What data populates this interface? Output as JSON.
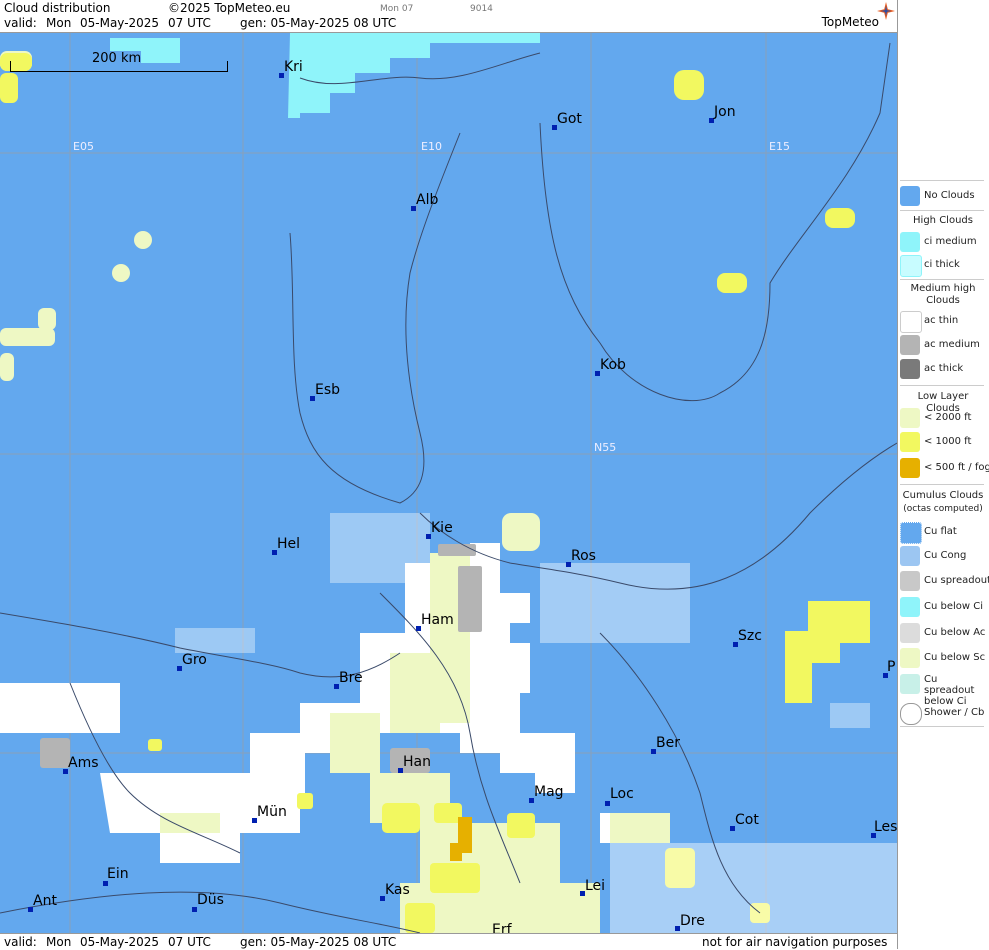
{
  "header": {
    "title": "Cloud distribution",
    "copyright": "©2025 TopMeteo.eu",
    "small1": "Mon 07",
    "small2": "9014",
    "valid_label": "valid:",
    "valid_day": "Mon",
    "valid_date": "05-May-2025",
    "valid_time": "07 UTC",
    "gen": "gen: 05-May-2025 08 UTC",
    "logo": "TopMeteo"
  },
  "footer": {
    "valid_label": "valid:",
    "valid_day": "Mon",
    "valid_date": "05-May-2025",
    "valid_time": "07 UTC",
    "gen": "gen: 05-May-2025 08 UTC",
    "disclaimer": "not for air navigation purposes"
  },
  "map": {
    "scale_label": "200 km",
    "coords": {
      "e05": "E05",
      "e10": "E10",
      "e15": "E15",
      "n55": "N55"
    },
    "cities": {
      "kri": "Kri",
      "got": "Got",
      "jon": "Jon",
      "alb": "Alb",
      "kob": "Kob",
      "esb": "Esb",
      "kie": "Kie",
      "hel": "Hel",
      "ros": "Ros",
      "ham": "Ham",
      "szc": "Szc",
      "gro": "Gro",
      "bre": "Bre",
      "p": "P",
      "ber": "Ber",
      "ams": "Ams",
      "han": "Han",
      "mag": "Mag",
      "loc": "Loc",
      "mun": "Mün",
      "cot": "Cot",
      "les": "Les",
      "ein": "Ein",
      "lei": "Lei",
      "kas": "Kas",
      "ant": "Ant",
      "dus": "Düs",
      "dre": "Dre",
      "erf": "Erf"
    },
    "colors": {
      "no_clouds": "#63a8ee",
      "ci_medium": "#8ff4fa",
      "low_2000": "#eef8c4",
      "low_1000": "#f2f860",
      "fog": "#e6b000",
      "ac_medium": "#b4b4b4",
      "white": "#ffffff"
    }
  },
  "legend": {
    "no_clouds": "No Clouds",
    "high_clouds": "High Clouds",
    "ci_medium": "ci medium",
    "ci_thick": "ci thick",
    "medium_high": "Medium high Clouds",
    "ac_thin": "ac thin",
    "ac_medium": "ac medium",
    "ac_thick": "ac thick",
    "low_layer": "Low Layer Clouds",
    "lt2000": "< 2000 ft",
    "lt1000": "< 1000 ft",
    "lt500": "< 500 ft / fog",
    "cumulus": "Cumulus Clouds",
    "cumulus_sub": "(octas computed)",
    "cu_flat": "Cu flat",
    "cu_cong": "Cu Cong",
    "cu_spreadout": "Cu spreadout",
    "cu_below_ci": "Cu below Ci",
    "cu_below_ac": "Cu below Ac",
    "cu_below_sc": "Cu below Sc",
    "cu_spread_below_ci": "Cu spreadout below Ci",
    "shower": "Shower / Cb"
  }
}
